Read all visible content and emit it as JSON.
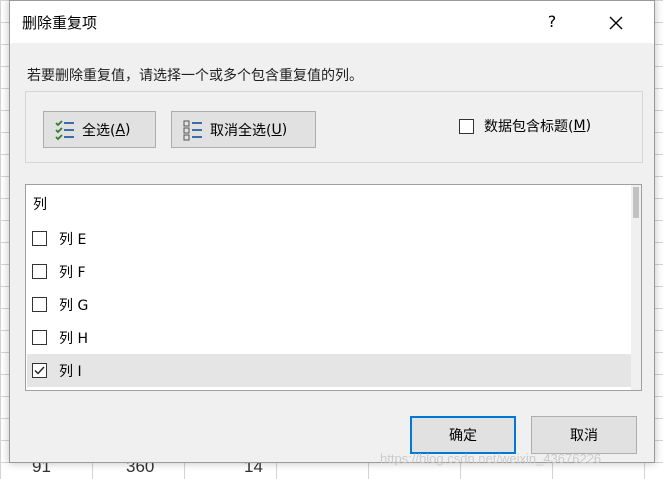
{
  "dialog": {
    "title": "删除重复项",
    "help_label": "?",
    "instruction": "若要删除重复值，请选择一个或多个包含重复值的列。",
    "select_all": {
      "label": "全选(",
      "key": "A",
      "suffix": ")"
    },
    "unselect_all": {
      "label": "取消全选(",
      "key": "U",
      "suffix": ")"
    },
    "header_option": {
      "label": "数据包含标题(",
      "key": "M",
      "suffix": ")",
      "checked": false
    },
    "list": {
      "header": "列",
      "items": [
        {
          "label": "列 E",
          "checked": false
        },
        {
          "label": "列 F",
          "checked": false
        },
        {
          "label": "列 G",
          "checked": false
        },
        {
          "label": "列 H",
          "checked": false
        },
        {
          "label": "列 I",
          "checked": true
        }
      ]
    },
    "ok_label": "确定",
    "cancel_label": "取消"
  },
  "sheet": {
    "visible_cells": [
      "91",
      "360",
      "14"
    ]
  },
  "watermark": "https://blog.csdn.net/weixin_43676226",
  "colors": {
    "accent": "#0078d7",
    "dialog_bg": "#f0f0f0",
    "selected_row": "#e5e5e5"
  }
}
